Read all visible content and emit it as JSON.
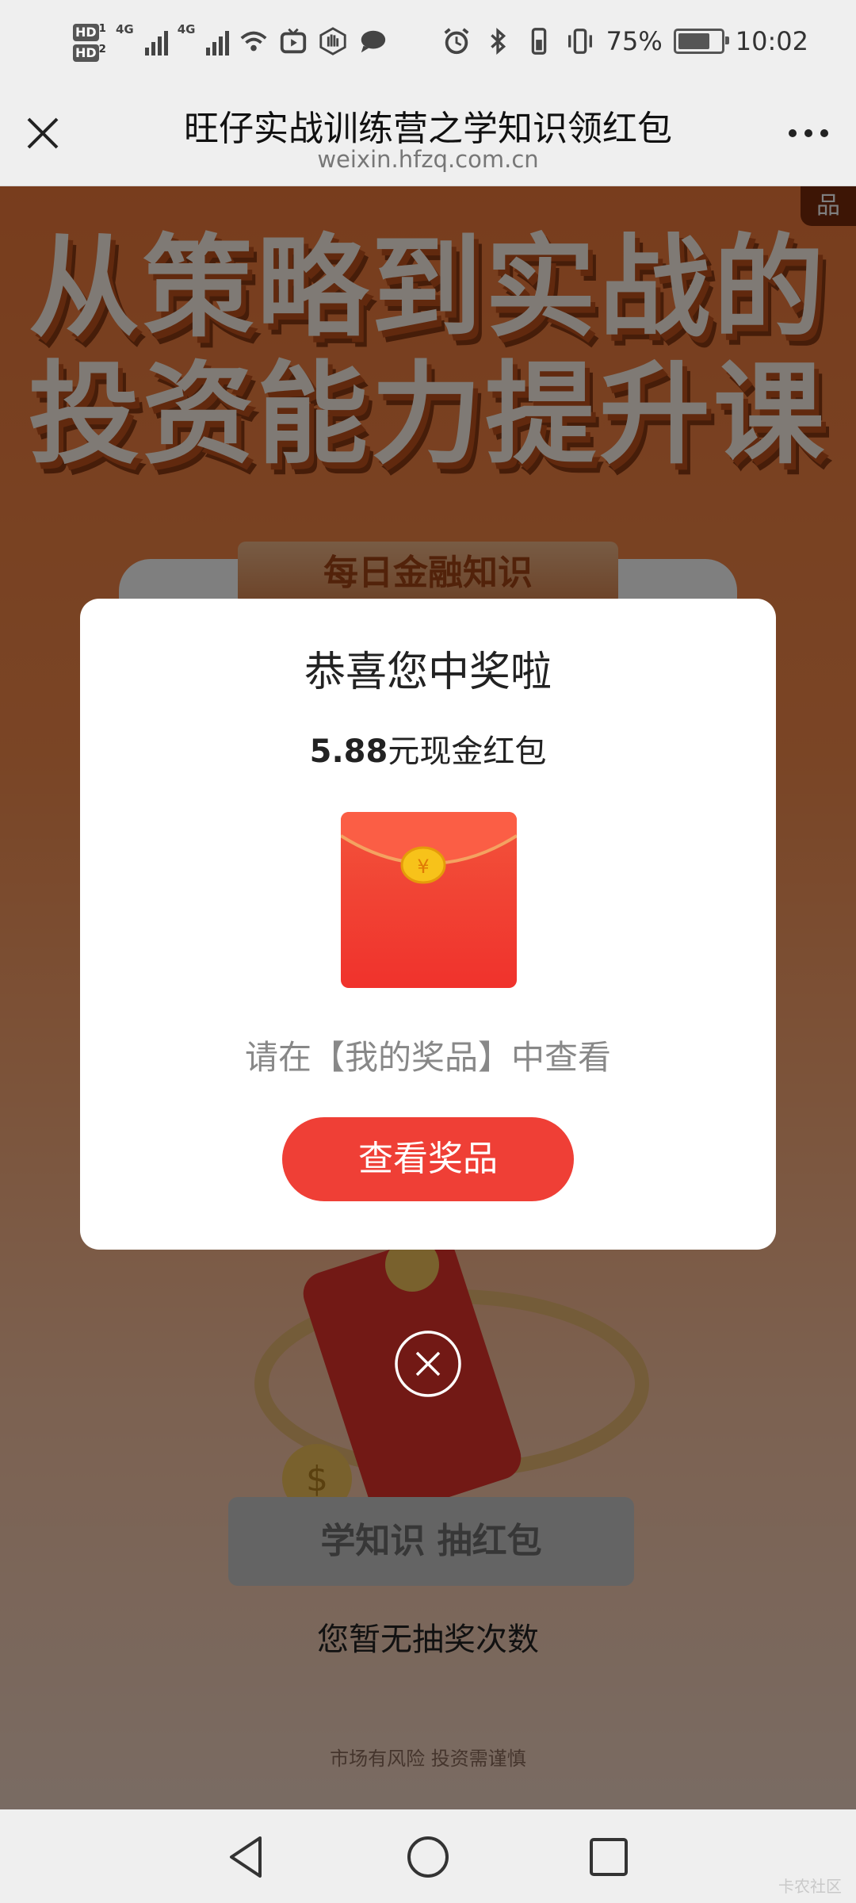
{
  "status_bar": {
    "hd1": "HD",
    "hd1_sub": "1",
    "hd2": "HD",
    "hd2_sub": "2",
    "network1": "4G",
    "network2": "4G",
    "battery_percent": "75%",
    "battery_level": 0.75,
    "time": "10:02"
  },
  "header": {
    "title": "旺仔实战训练营之学知识领红包",
    "url": "weixin.hfzq.com.cn"
  },
  "page": {
    "hero_line1": "从策略到实战的",
    "hero_line2": "投资能力提升课",
    "side_tag": "品",
    "ribbon": "每日金融知识",
    "draw_button": "学知识 抽红包",
    "no_chances": "您暂无抽奖次数",
    "risk": "市场有风险 投资需谨慎"
  },
  "modal": {
    "title": "恭喜您中奖啦",
    "prize_amount": "5.88",
    "prize_suffix": "元现金红包",
    "envelope_symbol": "¥",
    "tip": "请在【我的奖品】中查看",
    "button": "查看奖品"
  },
  "watermark": "卡农社区",
  "colors": {
    "accent_red": "#ef3f36",
    "envelope_red": "#f0322c",
    "coin_gold": "#f7c21a"
  }
}
